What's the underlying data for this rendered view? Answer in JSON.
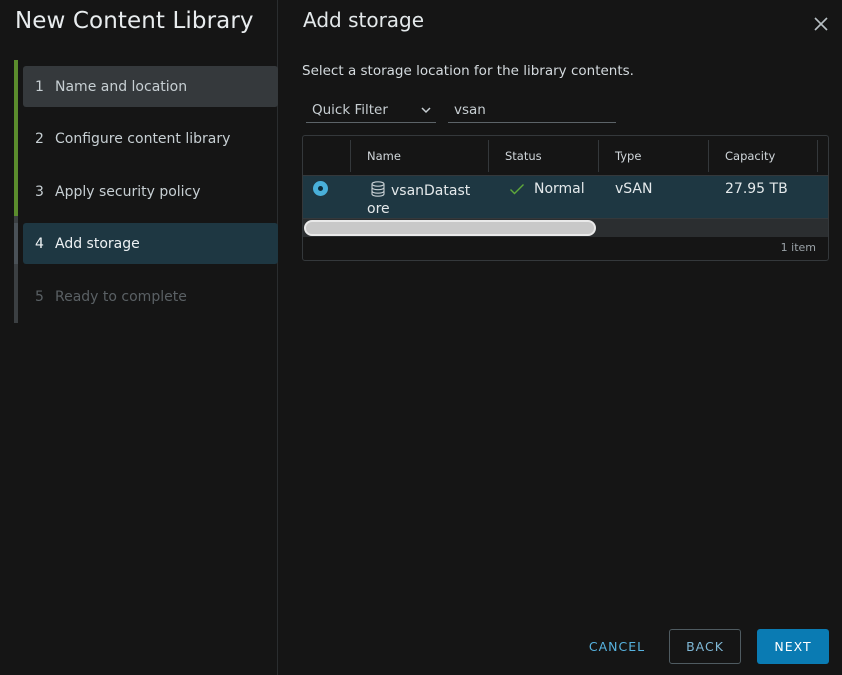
{
  "wizard": {
    "title": "New Content Library",
    "steps": [
      {
        "num": "1",
        "label": "Name and location"
      },
      {
        "num": "2",
        "label": "Configure content library"
      },
      {
        "num": "3",
        "label": "Apply security policy"
      },
      {
        "num": "4",
        "label": "Add storage"
      },
      {
        "num": "5",
        "label": "Ready to complete"
      }
    ]
  },
  "page": {
    "title": "Add storage",
    "instructions": "Select a storage location for the library contents."
  },
  "filter": {
    "type_label": "Quick Filter",
    "value": "vsan"
  },
  "grid": {
    "columns": [
      "Name",
      "Status",
      "Type",
      "Capacity"
    ],
    "rows": [
      {
        "name_line1": "vsanDatast",
        "name_line2": "ore",
        "status": "Normal",
        "type": "vSAN",
        "capacity": "27.95 TB"
      }
    ],
    "footer": "1 item"
  },
  "buttons": {
    "cancel": "CANCEL",
    "back": "BACK",
    "next": "NEXT"
  },
  "icons": {
    "close": "close-icon",
    "chevron": "chevron-down-icon",
    "datastore": "database-icon",
    "status_ok": "check-icon"
  },
  "colors": {
    "background": "#151515",
    "accent": "#49afd9",
    "primary_button": "#0a7bb3",
    "selected_row": "#1e3742",
    "step_done": "#5b8c2d",
    "status_ok": "#5fa83a"
  }
}
